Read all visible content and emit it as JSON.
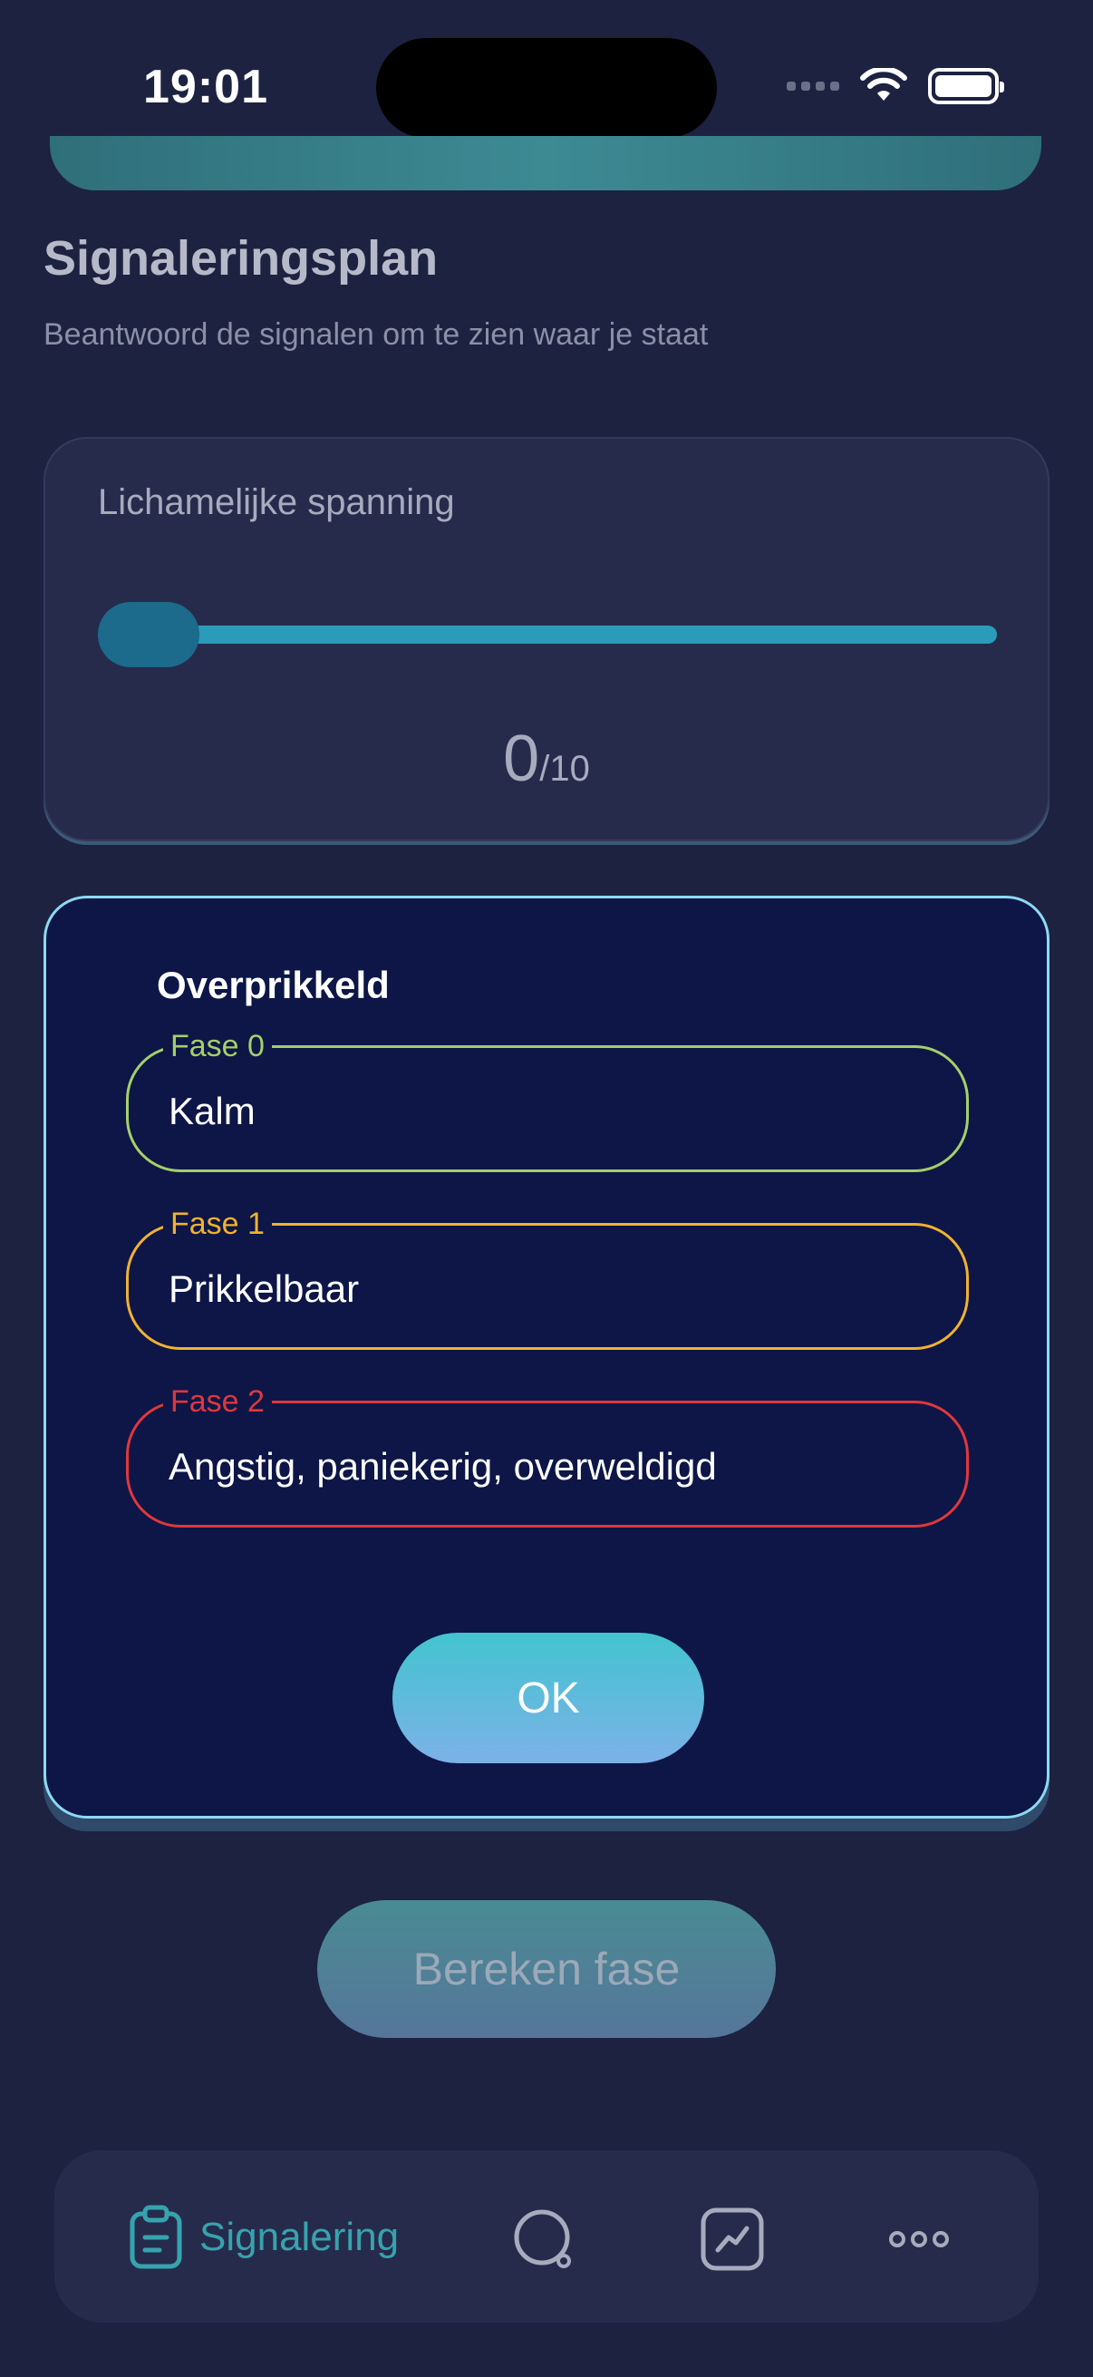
{
  "status_bar": {
    "time": "19:01"
  },
  "header": {
    "title": "Signaleringsplan",
    "subtitle": "Beantwoord de signalen om te zien waar je staat"
  },
  "slider_card": {
    "label": "Lichamelijke spanning",
    "value": "0",
    "max_label": "/10",
    "level": 0
  },
  "dialog": {
    "title": "Overprikkeld",
    "phases": [
      {
        "legend": "Fase 0",
        "value": "Kalm",
        "color": "#a5cf6a"
      },
      {
        "legend": "Fase 1",
        "value": "Prikkelbaar",
        "color": "#f0b22e"
      },
      {
        "legend": "Fase 2",
        "value": "Angstig, paniekerig, overweldigd",
        "color": "#e0373c"
      }
    ],
    "ok_label": "OK"
  },
  "calc_button": {
    "label": "Bereken fase"
  },
  "bottom_nav": {
    "items": [
      {
        "label": "Signalering",
        "icon": "clipboard-icon",
        "active": true
      },
      {
        "icon": "search-icon"
      },
      {
        "icon": "chart-icon"
      },
      {
        "icon": "more-icon"
      }
    ]
  },
  "colors": {
    "accent": "#36a3ad",
    "background": "#1d2241",
    "dialog_background": "#0d1647",
    "dialog_border": "#8dd9f2"
  }
}
